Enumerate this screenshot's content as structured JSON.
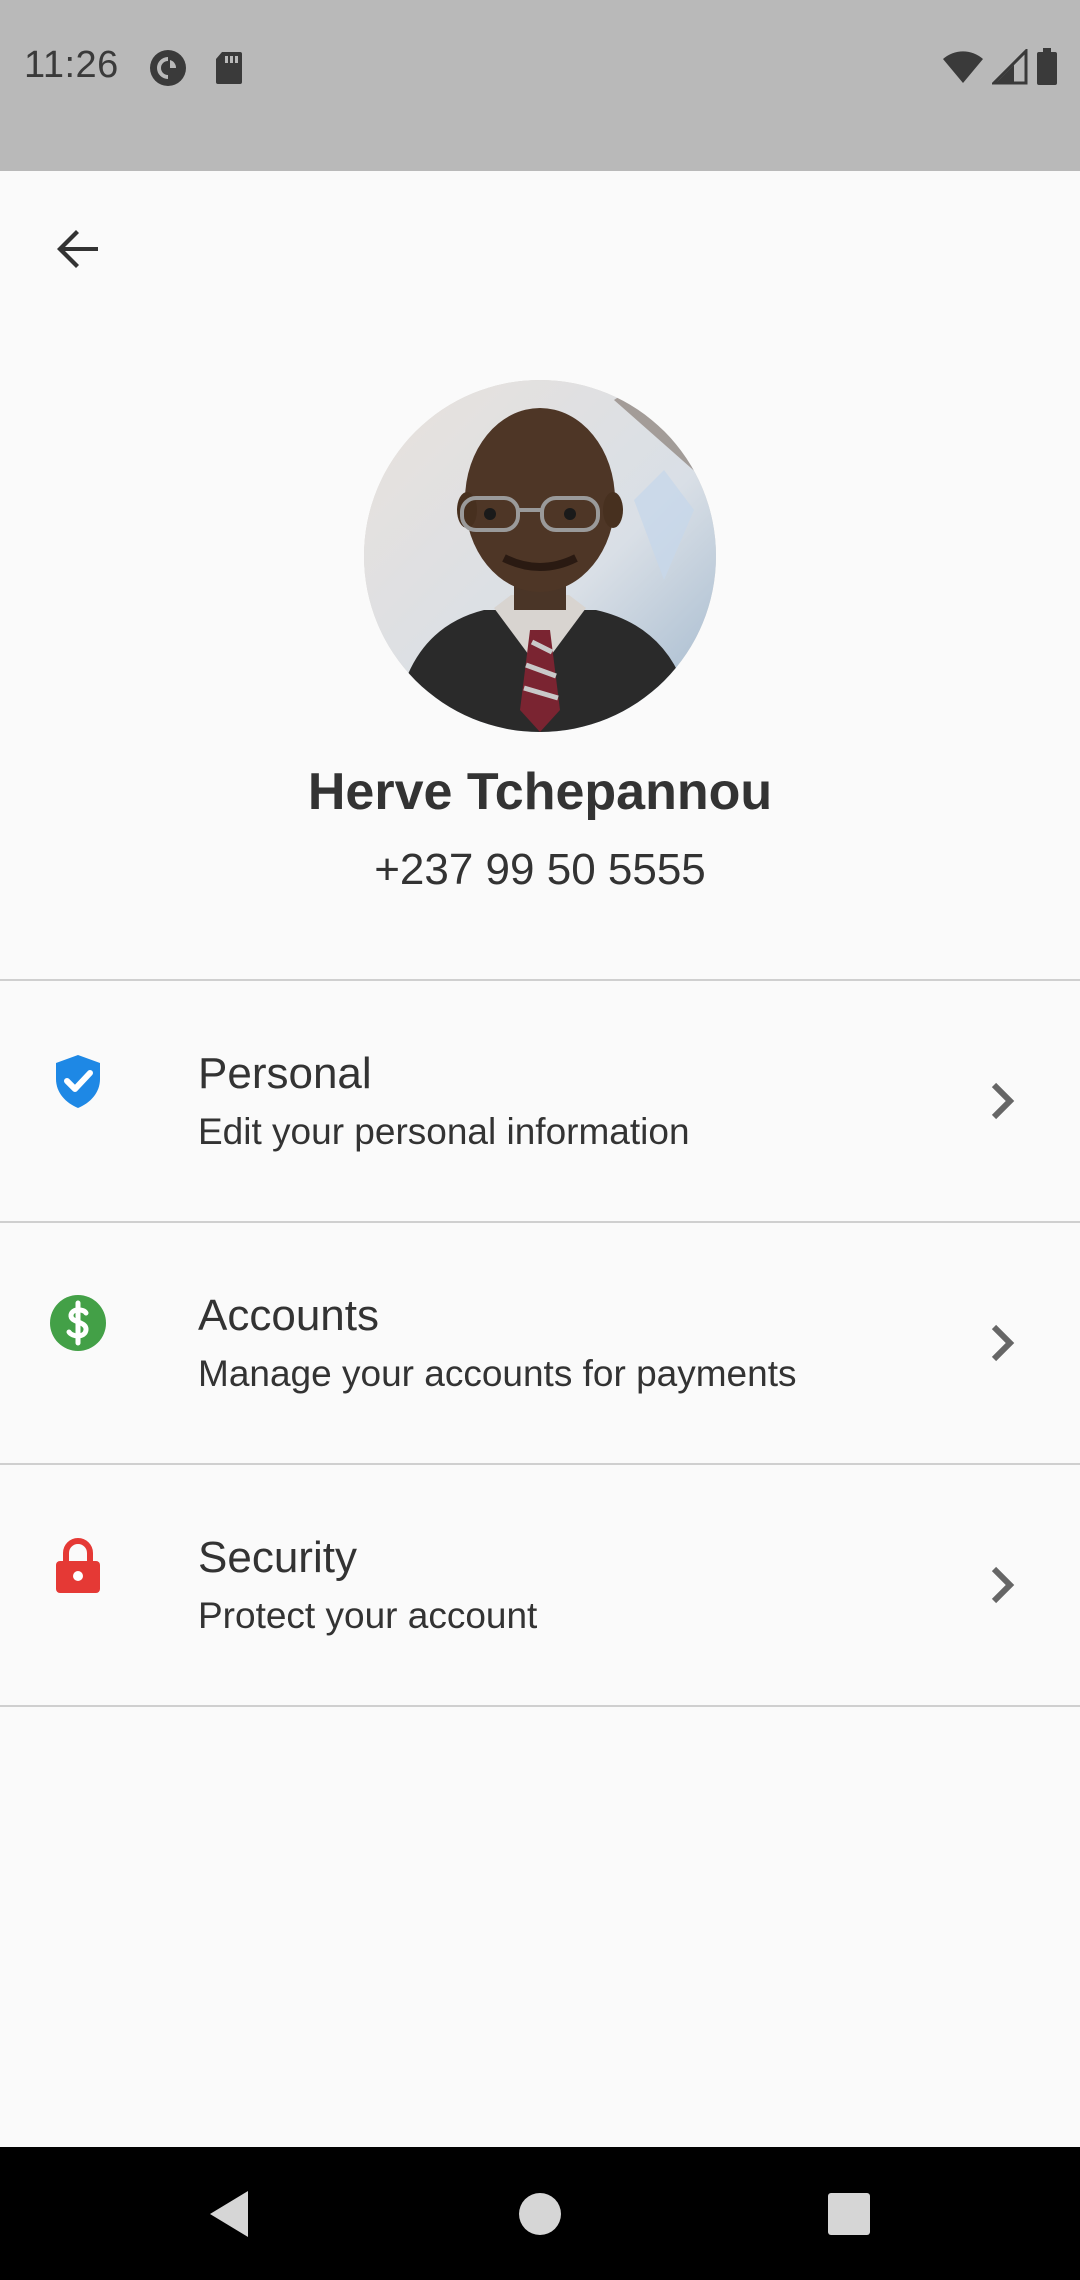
{
  "status_bar": {
    "time": "11:26",
    "left_icons": [
      "pocket-casts-icon",
      "sd-card-icon"
    ],
    "right_icons": [
      "wifi-icon",
      "cell-signal-icon",
      "battery-icon"
    ]
  },
  "app_bar": {
    "back_icon": "arrow-back-icon"
  },
  "profile": {
    "name": "Herve Tchepannou",
    "phone": "+237 99 50 5555"
  },
  "menu": {
    "items": [
      {
        "title": "Personal",
        "subtitle": "Edit your personal information",
        "icon": "verified-shield-icon",
        "icon_color": "#1e88e5"
      },
      {
        "title": "Accounts",
        "subtitle": "Manage your accounts for payments",
        "icon": "dollar-circle-icon",
        "icon_color": "#43a047"
      },
      {
        "title": "Security",
        "subtitle": "Protect your account",
        "icon": "lock-icon",
        "icon_color": "#e53935"
      }
    ]
  },
  "nav_bar": {
    "buttons": [
      "back-triangle-icon",
      "home-circle-icon",
      "recents-square-icon"
    ]
  }
}
